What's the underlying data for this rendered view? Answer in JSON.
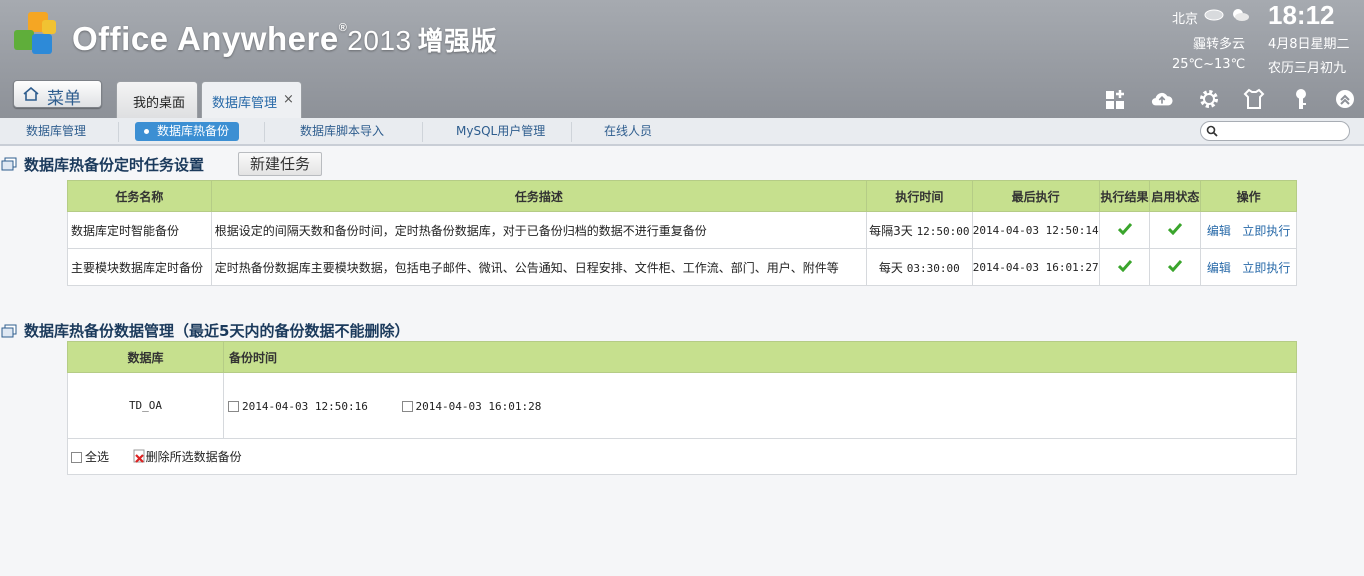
{
  "header": {
    "logo_text": "Office Anywhere",
    "registered": "®",
    "year": "2013",
    "edition": "增强版",
    "city": "北京",
    "weather_desc": "霾转多云",
    "temperature": "25℃~13℃",
    "time": "18:12",
    "date": "4月8日星期二",
    "lunar": "农历三月初九"
  },
  "menu": {
    "label": "菜单"
  },
  "tabs": [
    {
      "label": "我的桌面"
    },
    {
      "label": "数据库管理",
      "close": "×"
    }
  ],
  "toolbar_icons": [
    "grid-add-icon",
    "cloud-icon",
    "gear-icon",
    "shirt-icon",
    "key-icon",
    "collapse-icon"
  ],
  "subnav": {
    "items": [
      {
        "label": "数据库管理"
      },
      {
        "label": "数据库热备份",
        "active": true
      },
      {
        "label": "数据库脚本导入"
      },
      {
        "label": "MySQL用户管理"
      },
      {
        "label": "在线人员"
      }
    ]
  },
  "tasks": {
    "title": "数据库热备份定时任务设置",
    "new_task_label": "新建任务",
    "headers": [
      "任务名称",
      "任务描述",
      "执行时间",
      "最后执行",
      "执行结果",
      "启用状态",
      "操作"
    ],
    "rows": [
      {
        "name": "数据库定时智能备份",
        "desc": "根据设定的间隔天数和备份时间，定时热备份数据库，对于已备份归档的数据不进行重复备份",
        "exec_prefix": "每隔3天",
        "exec_time": "12:50:00",
        "last_run": "2014-04-03 12:50:14",
        "edit": "编辑",
        "run": "立即执行"
      },
      {
        "name": "主要模块数据库定时备份",
        "desc": "定时热备份数据库主要模块数据，包括电子邮件、微讯、公告通知、日程安排、文件柜、工作流、部门、用户、附件等",
        "exec_prefix": "每天",
        "exec_time": "03:30:00",
        "last_run": "2014-04-03 16:01:27",
        "edit": "编辑",
        "run": "立即执行"
      }
    ]
  },
  "backups": {
    "title": "数据库热备份数据管理（最近5天内的备份数据不能删除）",
    "headers": [
      "数据库",
      "备份时间"
    ],
    "database": "TD_OA",
    "times": [
      "2014-04-03 12:50:16",
      "2014-04-03 16:01:28"
    ],
    "select_all": "全选",
    "delete_label": "删除所选数据备份"
  },
  "colors": {
    "header_bg": "#9a9ea4",
    "accent": "#3c8fd3",
    "table_header": "#c6e08e",
    "link": "#2769a8"
  }
}
